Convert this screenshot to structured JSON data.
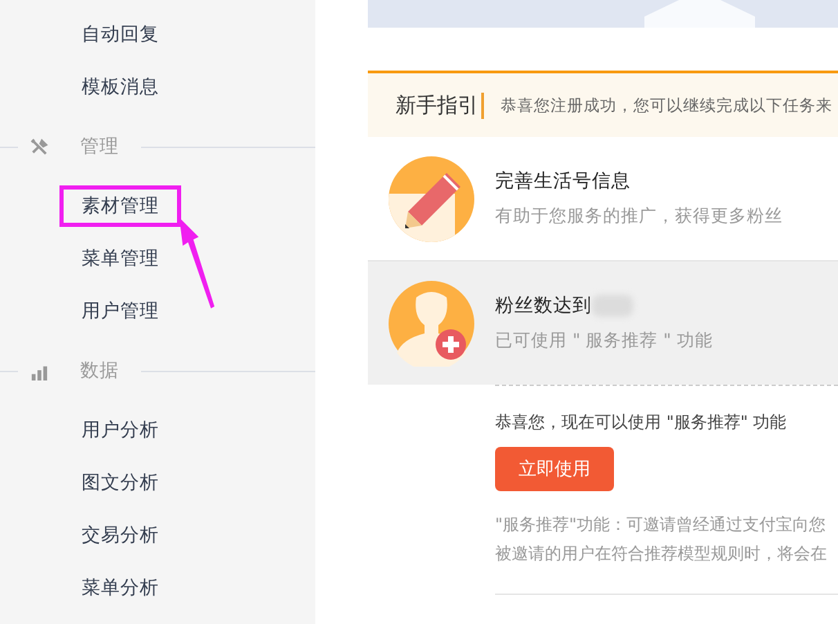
{
  "sidebar": {
    "items": [
      {
        "kind": "item",
        "label": "自动回复",
        "highlighted": false
      },
      {
        "kind": "item",
        "label": "模板消息",
        "highlighted": false
      },
      {
        "kind": "section",
        "label": "管理"
      },
      {
        "kind": "item",
        "label": "素材管理",
        "highlighted": true
      },
      {
        "kind": "item",
        "label": "菜单管理",
        "highlighted": false
      },
      {
        "kind": "item",
        "label": "用户管理",
        "highlighted": false
      },
      {
        "kind": "section",
        "label": "数据"
      },
      {
        "kind": "item",
        "label": "用户分析",
        "highlighted": false
      },
      {
        "kind": "item",
        "label": "图文分析",
        "highlighted": false
      },
      {
        "kind": "item",
        "label": "交易分析",
        "highlighted": false
      },
      {
        "kind": "item",
        "label": "菜单分析",
        "highlighted": false
      }
    ]
  },
  "guide": {
    "title": "新手指引",
    "subtitle": "恭喜您注册成功，您可以继续完成以下任务来",
    "tasks": [
      {
        "title": "完善生活号信息",
        "desc": "有助于您服务的推广，获得更多粉丝",
        "expanded": false,
        "redacted": false
      },
      {
        "title": "粉丝数达到",
        "desc": "已可使用 \" 服务推荐 \" 功能",
        "expanded": true,
        "redacted": true,
        "detail": {
          "message": "恭喜您，现在可以使用 \"服务推荐\" 功能",
          "button": "立即使用",
          "notes": [
            "\"服务推荐\"功能：可邀请曾经通过支付宝向您",
            "被邀请的用户在符合推荐模型规则时，将会在"
          ]
        }
      }
    ]
  }
}
